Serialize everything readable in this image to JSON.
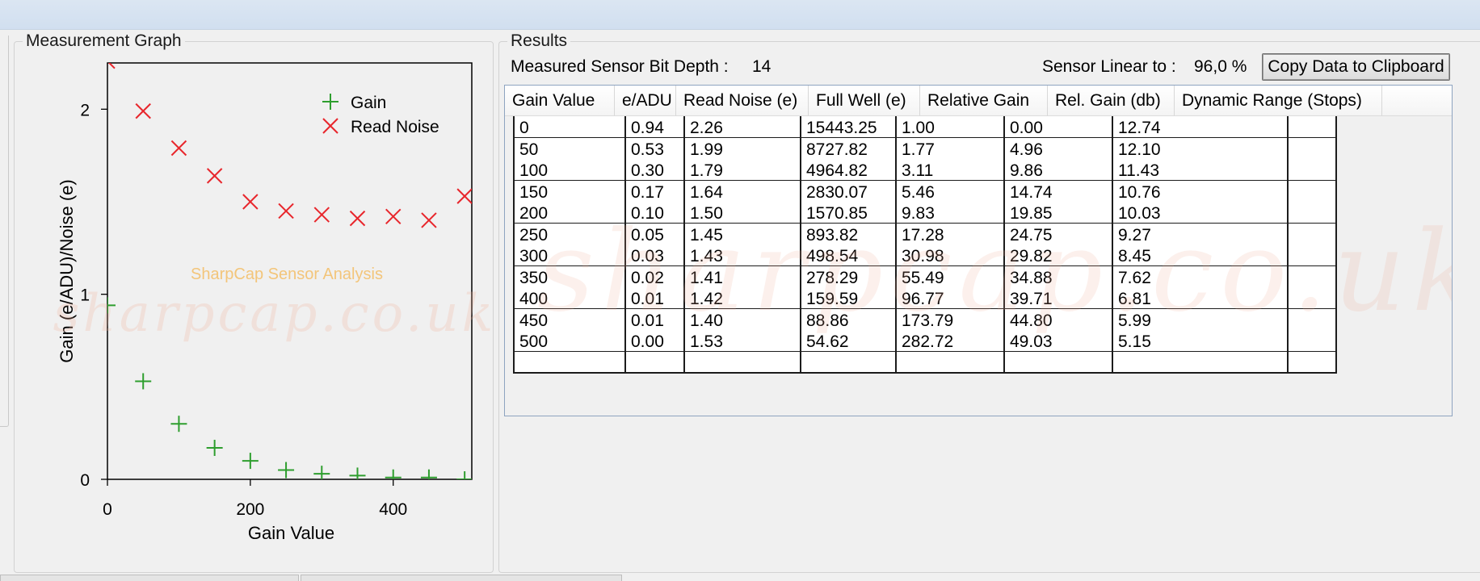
{
  "graph": {
    "group_title": "Measurement Graph",
    "watermark_caption": "SharpCap Sensor Analysis",
    "watermark_url": "sharpcap.co.uk",
    "chart_data": {
      "type": "scatter",
      "xlabel": "Gain Value",
      "ylabel": "Gain (e/ADU)/Noise (e)",
      "xlim": [
        0,
        510
      ],
      "ylim": [
        0,
        2.25
      ],
      "x_ticks": [
        0,
        200,
        400
      ],
      "y_ticks": [
        0,
        1,
        2
      ],
      "legend_position": "top-right",
      "grid": false,
      "series": [
        {
          "name": "Gain",
          "marker": "+",
          "color": "#2e9e2e",
          "x": [
            0,
            50,
            100,
            150,
            200,
            250,
            300,
            350,
            400,
            450,
            500
          ],
          "y": [
            0.94,
            0.53,
            0.3,
            0.17,
            0.1,
            0.05,
            0.03,
            0.02,
            0.01,
            0.01,
            0.0
          ]
        },
        {
          "name": "Read Noise",
          "marker": "x",
          "color": "#e8262c",
          "x": [
            0,
            50,
            100,
            150,
            200,
            250,
            300,
            350,
            400,
            450,
            500
          ],
          "y": [
            2.26,
            1.99,
            1.79,
            1.64,
            1.5,
            1.45,
            1.43,
            1.41,
            1.42,
            1.4,
            1.53
          ]
        }
      ]
    }
  },
  "results": {
    "group_title": "Results",
    "bit_depth_label": "Measured Sensor Bit Depth :",
    "bit_depth_value": "14",
    "linear_label": "Sensor Linear to :",
    "linear_value": "96,0 %",
    "copy_button_label": "Copy Data to Clipboard",
    "columns": [
      "Gain Value",
      "e/ADU",
      "Read Noise (e)",
      "Full Well (e)",
      "Relative Gain",
      "Rel. Gain (db)",
      "Dynamic Range (Stops)"
    ],
    "rows": [
      [
        "0",
        "0.94",
        "2.26",
        "15443.25",
        "1.00",
        "0.00",
        "12.74"
      ],
      [
        "50",
        "0.53",
        "1.99",
        "8727.82",
        "1.77",
        "4.96",
        "12.10"
      ],
      [
        "100",
        "0.30",
        "1.79",
        "4964.82",
        "3.11",
        "9.86",
        "11.43"
      ],
      [
        "150",
        "0.17",
        "1.64",
        "2830.07",
        "5.46",
        "14.74",
        "10.76"
      ],
      [
        "200",
        "0.10",
        "1.50",
        "1570.85",
        "9.83",
        "19.85",
        "10.03"
      ],
      [
        "250",
        "0.05",
        "1.45",
        "893.82",
        "17.28",
        "24.75",
        "9.27"
      ],
      [
        "300",
        "0.03",
        "1.43",
        "498.54",
        "30.98",
        "29.82",
        "8.45"
      ],
      [
        "350",
        "0.02",
        "1.41",
        "278.29",
        "55.49",
        "34.88",
        "7.62"
      ],
      [
        "400",
        "0.01",
        "1.42",
        "159.59",
        "96.77",
        "39.71",
        "6.81"
      ],
      [
        "450",
        "0.01",
        "1.40",
        "88.86",
        "173.79",
        "44.80",
        "5.99"
      ],
      [
        "500",
        "0.00",
        "1.53",
        "54.62",
        "282.72",
        "49.03",
        "5.15"
      ],
      [
        "",
        "",
        "",
        "",
        "",
        "",
        ""
      ]
    ]
  }
}
